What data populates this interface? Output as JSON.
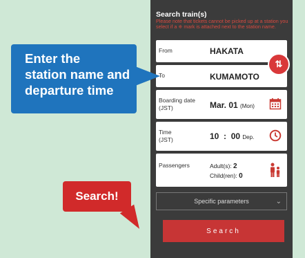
{
  "panel": {
    "title": "Search train(s)",
    "note": "Please note that tickets cannot be picked up at a station you select if a ※ mark is attached next to the station name."
  },
  "from": {
    "label": "From",
    "value": "HAKATA"
  },
  "to": {
    "label": "To",
    "value": "KUMAMOTO"
  },
  "swap_icon": "⇅",
  "boarding": {
    "label_line1": "Boarding date",
    "label_line2": "(JST)",
    "date": "Mar. 01",
    "weekday": "(Mon)"
  },
  "time": {
    "label_line1": "Time",
    "label_line2": "(JST)",
    "hour": "10",
    "sep": ":",
    "minute": "00",
    "type": "Dep."
  },
  "passengers": {
    "label": "Passengers",
    "adults_label": "Adult(s):",
    "adults": "2",
    "children_label": "Child(ren):",
    "children": "0"
  },
  "specific_parameters": {
    "label": "Specific parameters",
    "chevron": "⌄"
  },
  "search_button": {
    "label": "Search"
  },
  "callouts": {
    "enter_station_line1": "Enter the",
    "enter_station_line2": "station name and",
    "enter_station_line3": "departure time",
    "search": "Search!"
  },
  "colors": {
    "accent": "#d9383a",
    "panel_bg": "#3b3b3b",
    "callout_blue": "#1f74bd",
    "callout_red": "#d12a2a"
  }
}
